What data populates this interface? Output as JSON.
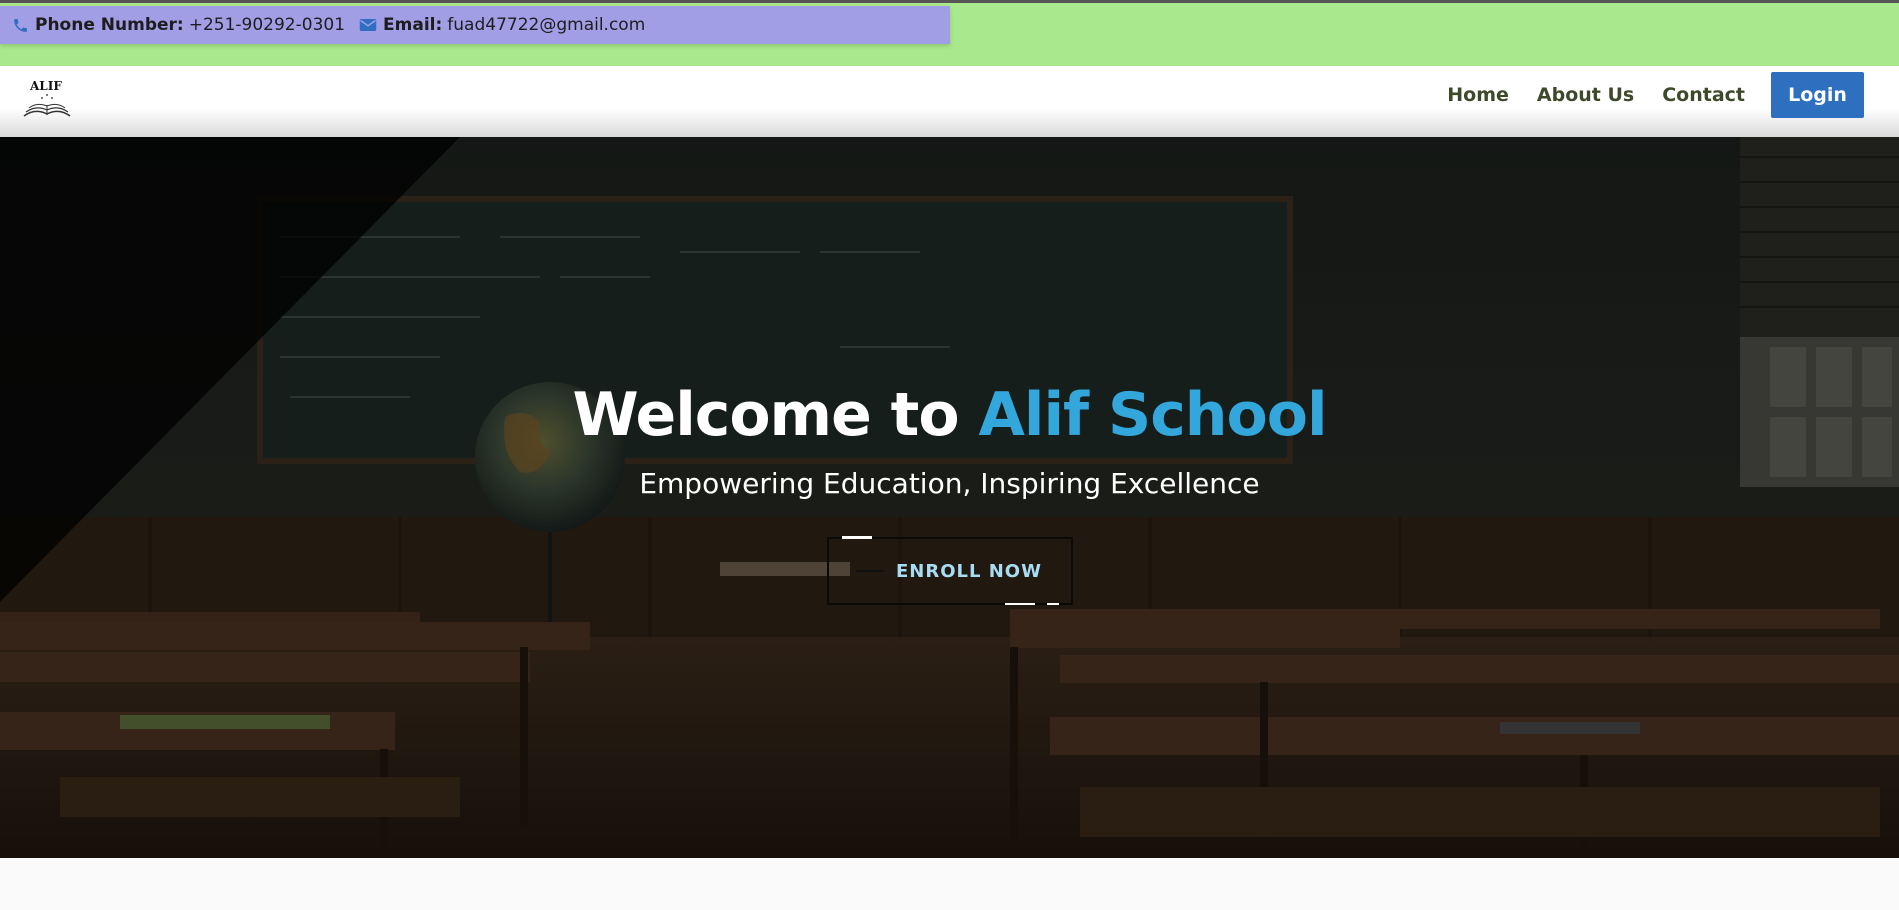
{
  "contact": {
    "phone_label": "Phone Number:",
    "phone_value": "+251-90292-0301",
    "email_label": "Email:",
    "email_value": "fuad47722@gmail.com"
  },
  "logo": {
    "text": "ALIF"
  },
  "nav": {
    "items": [
      {
        "label": "Home"
      },
      {
        "label": "About Us"
      },
      {
        "label": "Contact"
      }
    ],
    "login_label": "Login"
  },
  "hero": {
    "title_prefix": "Welcome to ",
    "title_accent": "Alif School",
    "subtitle": "Empowering Education, Inspiring Excellence",
    "cta_label": "ENROLL NOW"
  },
  "colors": {
    "topbar_green": "#a9e88c",
    "contact_strip": "#a29ee6",
    "login_blue": "#2f6fc0",
    "accent_blue": "#33a7dc",
    "nav_text": "#3d4a2a"
  }
}
